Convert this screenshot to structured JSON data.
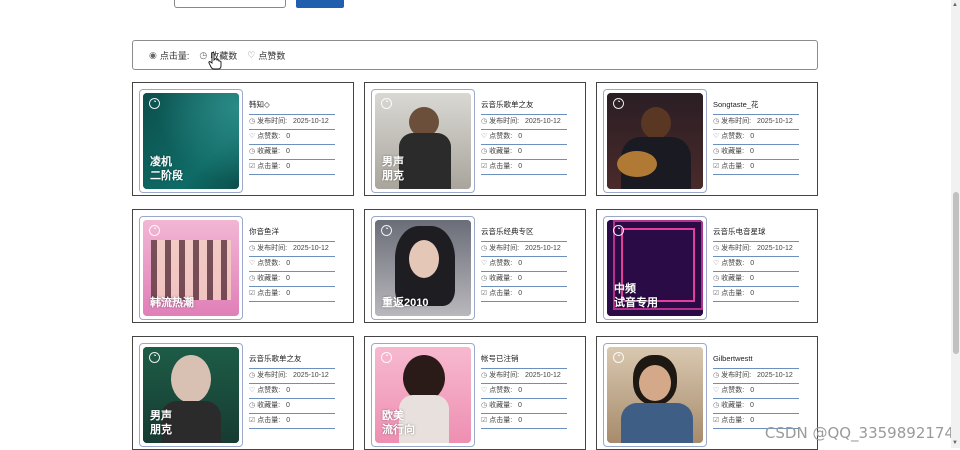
{
  "sortbar": {
    "views_label": "点击量:",
    "favorites_label": "收藏数",
    "likes_label": "点赞数"
  },
  "labels": {
    "publish": "发布时间:",
    "likes": "点赞数:",
    "favorites": "收藏量:",
    "views": "点击量:"
  },
  "cards": [
    {
      "title": "韩知◇",
      "caption_line1": "凌机",
      "caption_line2": "二阶段",
      "date": "2025-10-12",
      "likes": "0",
      "favorites": "0",
      "views": "0",
      "bg": "#0f5a57"
    },
    {
      "title": "云音乐歌单之友",
      "caption_line1": "男声",
      "caption_line2": "朋克",
      "date": "2025-10-12",
      "likes": "0",
      "favorites": "0",
      "views": "0",
      "bg": "#c9c7c1"
    },
    {
      "title": "Songtaste_花",
      "caption_line1": "",
      "caption_line2": "",
      "date": "2025-10-12",
      "likes": "0",
      "favorites": "0",
      "views": "0",
      "bg": "#2a1e24"
    },
    {
      "title": "你音鱼洋",
      "caption_line1": "韩流热潮",
      "caption_line2": "",
      "date": "2025-10-12",
      "likes": "0",
      "favorites": "0",
      "views": "0",
      "bg": "#e68fc0"
    },
    {
      "title": "云音乐经典专区",
      "caption_line1": "重返2010",
      "caption_line2": "",
      "date": "2025-10-12",
      "likes": "0",
      "favorites": "0",
      "views": "0",
      "bg": "#7d7e86"
    },
    {
      "title": "云音乐电音星球",
      "caption_line1": "中频",
      "caption_line2": "试音专用",
      "date": "2025-10-12",
      "likes": "0",
      "favorites": "0",
      "views": "0",
      "bg": "#3a0f5c"
    },
    {
      "title": "云音乐歌单之友",
      "caption_line1": "男声",
      "caption_line2": "朋克",
      "date": "2025-10-12",
      "likes": "0",
      "favorites": "0",
      "views": "0",
      "bg": "#1f4c3c"
    },
    {
      "title": "帐号已注销",
      "caption_line1": "欧美",
      "caption_line2": "流行向",
      "date": "2025-10-12",
      "likes": "0",
      "favorites": "0",
      "views": "0",
      "bg": "#f2a6c2"
    },
    {
      "title": "Gilbertwestt",
      "caption_line1": "",
      "caption_line2": "",
      "date": "2025-10-12",
      "likes": "0",
      "favorites": "0",
      "views": "0",
      "bg": "#c9b39a"
    }
  ],
  "watermark": "CSDN @QQ_3359892174"
}
